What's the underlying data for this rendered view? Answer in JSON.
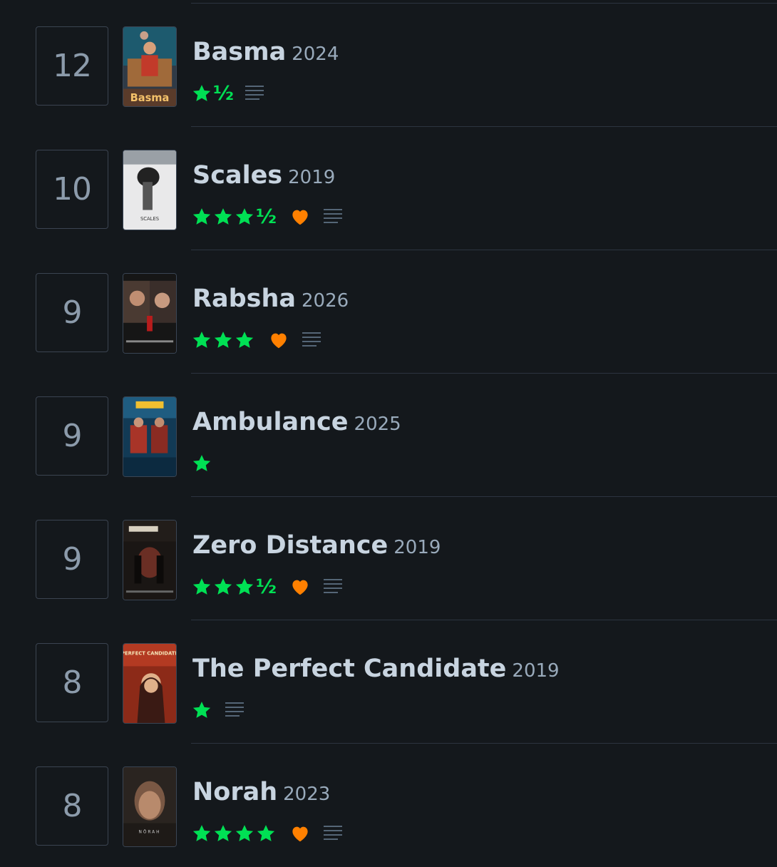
{
  "colors": {
    "background": "#14181c",
    "star_green": "#00e054",
    "heart_orange": "#ff8000",
    "title": "#c8d4e0",
    "muted": "#99aabb",
    "divider": "#2c3440"
  },
  "films": [
    {
      "rank": "12",
      "title": "Basma",
      "year": "2024",
      "stars": 1,
      "half": true,
      "liked": false,
      "review": true,
      "poster_text": "Basma"
    },
    {
      "rank": "10",
      "title": "Scales",
      "year": "2019",
      "stars": 3,
      "half": true,
      "liked": true,
      "review": true,
      "poster_text": "SCALES"
    },
    {
      "rank": "9",
      "title": "Rabsha",
      "year": "2026",
      "stars": 3,
      "half": false,
      "liked": true,
      "review": true,
      "poster_text": ""
    },
    {
      "rank": "9",
      "title": "Ambulance",
      "year": "2025",
      "stars": 1,
      "half": false,
      "liked": false,
      "review": false,
      "poster_text": ""
    },
    {
      "rank": "9",
      "title": "Zero Distance",
      "year": "2019",
      "stars": 3,
      "half": true,
      "liked": true,
      "review": true,
      "poster_text": ""
    },
    {
      "rank": "8",
      "title": "The Perfect Candidate",
      "year": "2019",
      "stars": 1,
      "half": false,
      "liked": false,
      "review": true,
      "poster_text": "PERFECT CANDIDATE"
    },
    {
      "rank": "8",
      "title": "Norah",
      "year": "2023",
      "stars": 4,
      "half": false,
      "liked": true,
      "review": true,
      "poster_text": "NŌRAH"
    }
  ],
  "icons": {
    "star": "star-icon",
    "half_star": "½",
    "heart": "heart-icon",
    "review": "review-lines-icon"
  }
}
